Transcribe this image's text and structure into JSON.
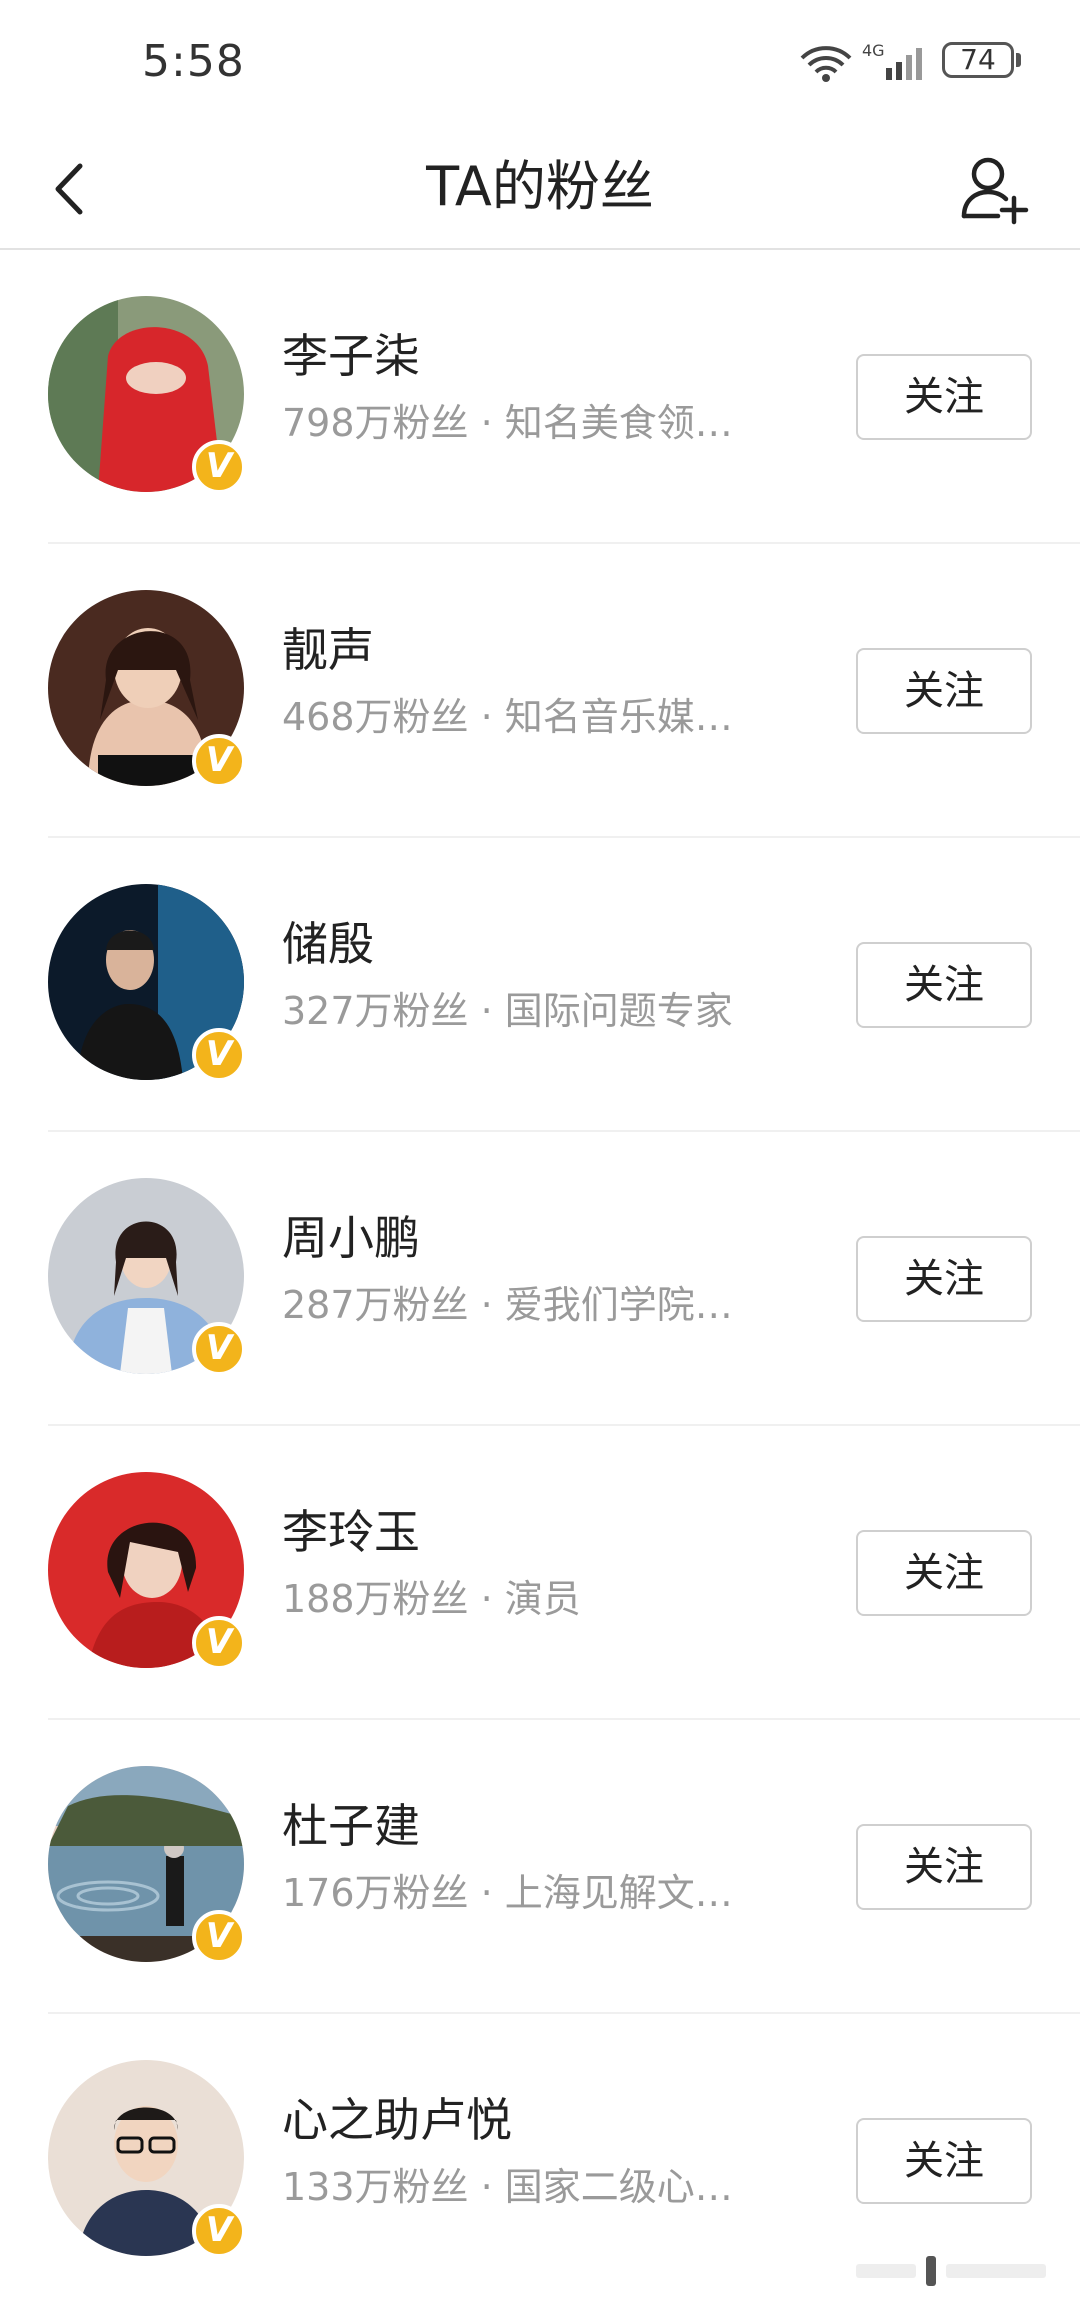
{
  "status_bar": {
    "time": "5:58",
    "network": "4G",
    "battery": "74"
  },
  "nav": {
    "title": "TA的粉丝"
  },
  "users": [
    {
      "name": "李子柒",
      "fans": "798万粉丝",
      "desc": "知名美食领…",
      "follow_label": "关注"
    },
    {
      "name": "靓声",
      "fans": "468万粉丝",
      "desc": "知名音乐媒…",
      "follow_label": "关注"
    },
    {
      "name": "储殷",
      "fans": "327万粉丝",
      "desc": "国际问题专家",
      "follow_label": "关注"
    },
    {
      "name": "周小鹏",
      "fans": "287万粉丝",
      "desc": "爱我们学院…",
      "follow_label": "关注"
    },
    {
      "name": "李玲玉",
      "fans": "188万粉丝",
      "desc": "演员",
      "follow_label": "关注"
    },
    {
      "name": "杜子建",
      "fans": "176万粉丝",
      "desc": "上海见解文…",
      "follow_label": "关注"
    },
    {
      "name": "心之助卢悦",
      "fans": "133万粉丝",
      "desc": "国家二级心…",
      "follow_label": "关注"
    }
  ],
  "separator": " · ",
  "verified_badge": "V",
  "colors": {
    "badge": "#f3b41b",
    "subtext": "#9a9a9a",
    "divider": "#f0f0f0"
  }
}
